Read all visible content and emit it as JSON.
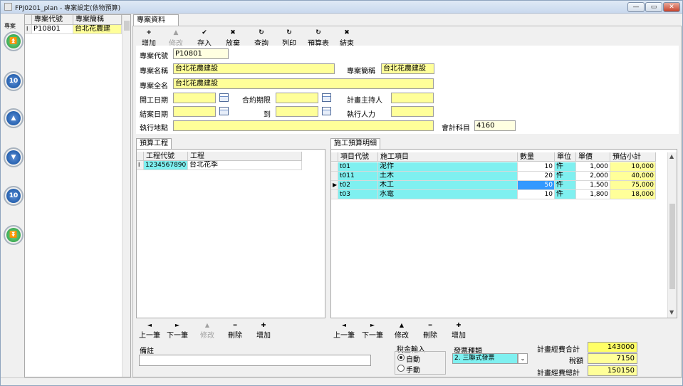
{
  "window": {
    "title": "FPJ0201_plan - 專案設定(依物預算)",
    "min": "—",
    "max": "▭",
    "close": "✕"
  },
  "left_nav": {
    "label": "專案",
    "btn_first": "⏫",
    "btn_prev10": "10",
    "btn_prev": "▲",
    "btn_next": "▼",
    "btn_next10": "10",
    "btn_last": "⏬"
  },
  "left_grid": {
    "columns": [
      "專案代號",
      "專案簡稱"
    ],
    "rows": [
      {
        "indicator": "I",
        "code": "P10801",
        "name": "台北花農建"
      }
    ]
  },
  "tab": {
    "label": "專案資料"
  },
  "toolbar": [
    {
      "icon": "+",
      "label": "增加",
      "enabled": true
    },
    {
      "icon": "▲",
      "label": "修改",
      "enabled": false
    },
    {
      "icon": "✔",
      "label": "存入",
      "enabled": true
    },
    {
      "icon": "✖",
      "label": "放棄",
      "enabled": true
    },
    {
      "icon": "↻",
      "label": "查詢",
      "enabled": true
    },
    {
      "icon": "↻",
      "label": "列印",
      "enabled": true
    },
    {
      "icon": "↻",
      "label": "預算表",
      "enabled": true
    },
    {
      "icon": "✖",
      "label": "結束",
      "enabled": true
    }
  ],
  "form": {
    "project_code_label": "專案代號",
    "project_code": "P10801",
    "project_name_label": "專案名稱",
    "project_name": "台北花農建設",
    "project_short_label": "專案簡稱",
    "project_short": "台北花農建設",
    "project_full_label": "專案全名",
    "project_full": "台北花農建設",
    "start_date_label": "開工日期",
    "start_date": "",
    "contract_label": "合約期限",
    "contract": "",
    "planner_label": "計畫主持人",
    "planner": "",
    "end_date_label": "結案日期",
    "end_date": "",
    "to_label": "到",
    "to": "",
    "executor_label": "執行人力",
    "executor": "",
    "location_label": "執行地點",
    "location": "",
    "account_label": "會計科目",
    "account": "4160"
  },
  "budget": {
    "tab": "預算工程",
    "columns": [
      "工程代號",
      "工程"
    ],
    "rows": [
      {
        "indicator": "I",
        "code": "1234567890",
        "name": "台北花季"
      }
    ],
    "nav": [
      {
        "icon": "◄",
        "label": "上一筆",
        "enabled": true
      },
      {
        "icon": "►",
        "label": "下一筆",
        "enabled": true
      },
      {
        "icon": "▲",
        "label": "修改",
        "enabled": false
      },
      {
        "icon": "━",
        "label": "刪除",
        "enabled": true
      },
      {
        "icon": "✚",
        "label": "增加",
        "enabled": true
      }
    ]
  },
  "detail": {
    "tab": "施工預算明細",
    "columns": [
      "項目代號",
      "施工項目",
      "數量",
      "單位",
      "單價",
      "預估小計"
    ],
    "rows": [
      {
        "indicator": "",
        "code": "t01",
        "item": "泥作",
        "qty": "10",
        "unit": "件",
        "price": "1,000",
        "subtotal": "10,000"
      },
      {
        "indicator": "",
        "code": "t011",
        "item": "土木",
        "qty": "20",
        "unit": "件",
        "price": "2,000",
        "subtotal": "40,000"
      },
      {
        "indicator": "▶",
        "code": "t02",
        "item": "木工",
        "qty": "50",
        "unit": "件",
        "price": "1,500",
        "subtotal": "75,000"
      },
      {
        "indicator": "",
        "code": "t03",
        "item": "水電",
        "qty": "10",
        "unit": "件",
        "price": "1,800",
        "subtotal": "18,000"
      }
    ],
    "nav": [
      {
        "icon": "◄",
        "label": "上一筆",
        "enabled": true
      },
      {
        "icon": "►",
        "label": "下一筆",
        "enabled": true
      },
      {
        "icon": "▲",
        "label": "修改",
        "enabled": true
      },
      {
        "icon": "━",
        "label": "刪除",
        "enabled": true
      },
      {
        "icon": "✚",
        "label": "增加",
        "enabled": true
      }
    ]
  },
  "bottom": {
    "note_label": "備註",
    "note": "",
    "tax_label": "稅金輸入",
    "tax_auto": "自動",
    "tax_manual": "手動",
    "invoice_label": "發票種類",
    "invoice_value": "2. 三聯式發票",
    "plan_total_label": "計畫經費合計",
    "plan_total": "143000",
    "tax_amount_label": "稅額",
    "tax_amount": "7150",
    "plan_grand_label": "計畫經費總計",
    "plan_grand": "150150"
  }
}
